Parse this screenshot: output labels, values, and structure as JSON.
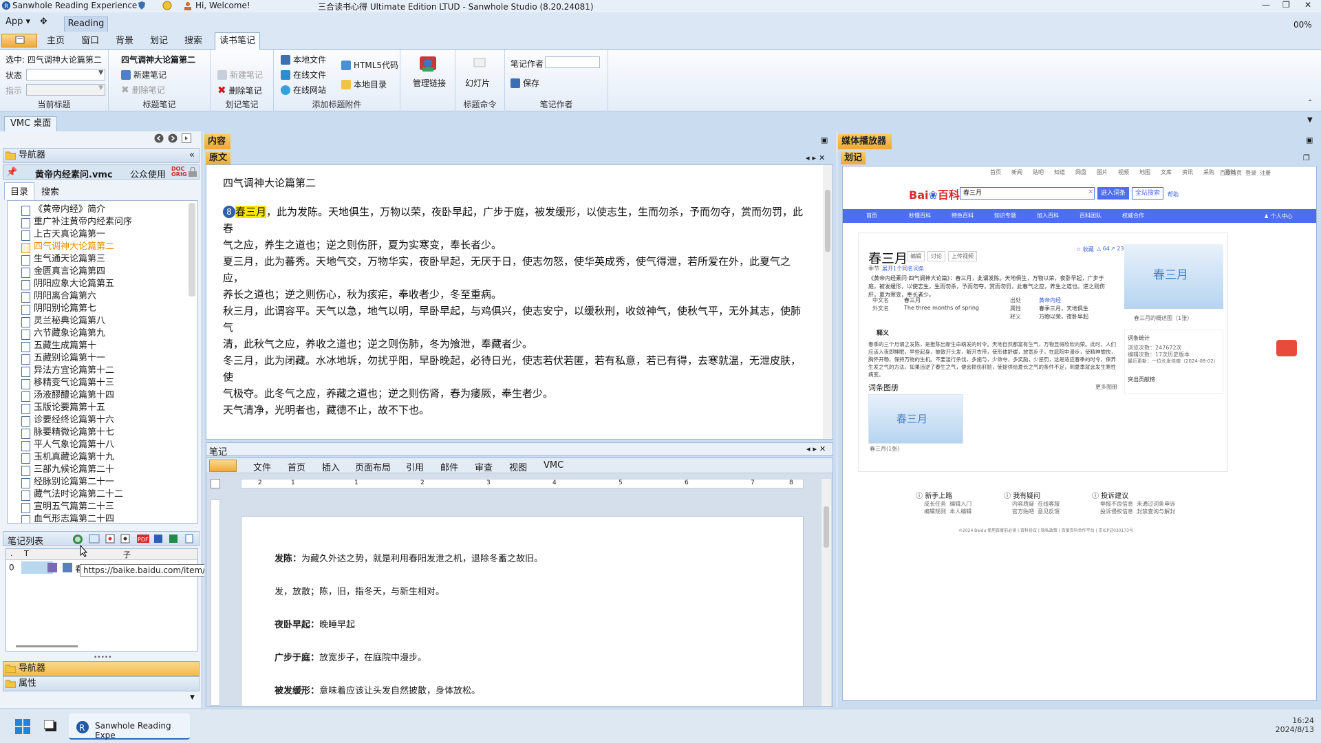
{
  "titlebar": {
    "app_name": "Sanwhole Reading Experience",
    "greeting": "Hi, Welcome!",
    "window_title": "三合读书心得 Ultimate Edition LTUD - Sanwhole Studio (8.20.24081)"
  },
  "tabrow": {
    "app_menu": "App",
    "reading_tab": "Reading",
    "zoom": "00%"
  },
  "menu": {
    "items": [
      "主页",
      "窗口",
      "背景",
      "划记",
      "搜索"
    ],
    "active": "读书笔记"
  },
  "ribbon": {
    "current": {
      "selected": "选中: 四气调神大论篇第二",
      "status_label": "状态",
      "indicator_label": "指示",
      "group": "当前标题"
    },
    "title_notes": {
      "title": "四气调神大论篇第二",
      "new": "新建笔记",
      "delete": "删除笔记",
      "group": "标题笔记"
    },
    "mark_notes": {
      "new": "新建笔记",
      "delete": "删除笔记",
      "group": "划记笔记"
    },
    "attach": {
      "local_file": "本地文件",
      "online_file": "在线文件",
      "online_site": "在线网站",
      "html5": "HTML5代码",
      "local_dir": "本地目录",
      "group": "添加标题附件"
    },
    "manage": {
      "label": "管理链接"
    },
    "slides": {
      "label": "幻灯片",
      "group": "标题命令"
    },
    "author": {
      "label": "笔记作者",
      "save": "保存",
      "group": "笔记作者"
    }
  },
  "vmc": {
    "tab": "VMC 桌面"
  },
  "left": {
    "navigator": "导航器",
    "file": "黄帝内经素问.vmc",
    "usage": "公众使用",
    "tabs": [
      "目录",
      "搜索"
    ],
    "tree": [
      "《黄帝内经》简介",
      "重广补注黄帝内经素问序",
      "上古天真论篇第一",
      "四气调神大论篇第二",
      "生气通天论篇第三",
      "金匮真言论篇第四",
      "阴阳应象大论篇第五",
      "阴阳离合篇第六",
      "阴阳别论篇第七",
      "灵兰秘典论篇第八",
      "六节藏象论篇第九",
      "五藏生成篇第十",
      "五藏别论篇第十一",
      "异法方宜论篇第十二",
      "移精变气论篇第十三",
      "汤液醪醴论篇第十四",
      "玉版论要篇第十五",
      "诊要经终论篇第十六",
      "脉要精微论篇第十七",
      "平人气象论篇第十八",
      "玉机真藏论篇第十九",
      "三部九候论篇第二十",
      "经脉别论篇第二十一",
      "藏气法时论篇第二十二",
      "宣明五气篇第二十三",
      "血气形志篇第二十四"
    ],
    "selected_index": 3,
    "notes_list": "笔记列表",
    "grid_headers": [
      ".",
      "T",
      "子"
    ],
    "grid_row": {
      "num": "0",
      "text": "春"
    },
    "bottom_nav": "导航器",
    "bottom_props": "属性"
  },
  "tooltip": "https://baike.baidu.com/item/%E6%98%A5%E4%B8%89%E6%9C%88/861835?fr=ge_ala",
  "content": {
    "header": "内容",
    "tab": "原文",
    "doc_title": "四气调神大论篇第二",
    "badge": "8",
    "highlight": "春三月",
    "p1a": "，此为发陈。天地俱生，万物以荣，夜卧早起，广步于庭，被发缓形，以使志生，生而勿杀，予而勿夺，赏而勿罚，此春",
    "p1b": "气之应，养生之道也；逆之则伤肝，夏为实寒变，奉长者少。",
    "p2a": "夏三月，此为蕃秀。天地气交，万物华实，夜卧早起，无厌于日，使志勿怒，使华英成秀，使气得泄，若所爱在外，此夏气之应，",
    "p2b": "养长之道也；逆之则伤心，秋为痎疟，奉收者少，冬至重病。",
    "p3a": "秋三月，此谓容平。天气以急，地气以明，早卧早起，与鸡俱兴，使志安宁，以缓秋刑，收敛神气，使秋气平，无外其志，使肺气",
    "p3b": "清，此秋气之应，养收之道也；逆之则伤肺，冬为飧泄，奉藏者少。",
    "p4a": "冬三月，此为闭藏。水冰地坼，勿扰乎阳，早卧晚起，必待日光，使志若伏若匿，若有私意，若已有得，去寒就温，无泄皮肤，使",
    "p4b": "气极夺。此冬气之应，养藏之道也；逆之则伤肾，春为痿厥，奉生者少。",
    "p5": "天气清净，光明者也，藏德不止，故不下也。",
    "notes_tab": "笔记",
    "word_menu": [
      "文件",
      "首页",
      "插入",
      "页面布局",
      "引用",
      "邮件",
      "审查",
      "视图",
      "VMC"
    ],
    "ruler": [
      "2",
      "1",
      "1",
      "2",
      "3",
      "4",
      "5",
      "6",
      "7",
      "8"
    ],
    "notes": [
      {
        "term": "发陈：",
        "text": "为藏久外达之势，就是利用春阳发泄之机，退除冬蓄之故旧。"
      },
      {
        "term": "",
        "text": "发，放散；陈，旧，指冬天，与新生相对。"
      },
      {
        "term": "夜卧早起：",
        "text": "晚睡早起"
      },
      {
        "term": "广步于庭：",
        "text": "放宽步子，在庭院中漫步。"
      },
      {
        "term": "被发缓形：",
        "text": "意味着应该让头发自然披散，身体放松。"
      }
    ]
  },
  "media": {
    "header": "媒体播放器",
    "tab": "划记",
    "baidu": {
      "toplinks": [
        "首页",
        "新闻",
        "贴吧",
        "知道",
        "网盘",
        "图片",
        "视频",
        "地图",
        "文库",
        "资讯",
        "采购",
        "百科"
      ],
      "toplinks_right": [
        "百度首页",
        "登录",
        "注册"
      ],
      "search_value": "春三月",
      "enter_btn": "进入词条",
      "search_btn": "全站搜索",
      "help": "帮助",
      "nav": [
        "首页",
        "秒懂百科",
        "特色百科",
        "知识专题",
        "加入百科",
        "百科团队",
        "权威合作"
      ],
      "nav_right": "个人中心",
      "term": "春三月",
      "term_sub": "季节",
      "poly": "展开1个同名词条",
      "btns": [
        "编辑",
        "讨论",
        "上传视频"
      ],
      "collect": "收藏",
      "likes": "64",
      "share": "23",
      "summary": "《黄帝内经素问·四气调神大论篇》：春三月，此谓发陈。天地俱生，万物以荣，夜卧早起，广步于庭，被发缓形，以使志生，生而勿杀，予而勿夺，赏而勿罚，此春气之应，养生之道也。逆之则伤肝，夏为寒变，奉长者少。",
      "info_l": [
        [
          "中文名",
          "春三月"
        ],
        [
          "外文名",
          "The three months of spring"
        ]
      ],
      "info_r": [
        [
          "出处",
          "黄帝内经"
        ],
        [
          "属性",
          "春季三月，天地俱生"
        ],
        [
          "释义",
          "万物以荣，夜卧早起"
        ]
      ],
      "section": "释义",
      "body": "春季的三个月谓之发陈，是推陈出新生命萌发的时令。天地自然都富有生气，万物显得欣欣向荣。此时，人们应该入夜即睡眠，早些起身，披散开头发，解开衣带，使形体舒缓，放宽步子，在庭院中漫步，使精神愉快，胸怀开畅，保持万物的生机。不要滥行杀伐，多施与，少敛夺，多奖励，少惩罚，这是适应春季的时令，保养生发之气的方法。如果违逆了春生之气，便会损伤肝脏，使提供给夏长之气的条件不足，到夏季就会发生寒性病变。",
      "album": "词条图册",
      "album_more": "更多图册",
      "image_text": "春三月",
      "album_caption": "春三月(1张)",
      "image_caption": "春三月的概述图（1张）",
      "stats_title": "词条统计",
      "stats": [
        "浏览次数：247672次",
        "编辑次数：17次历史版本",
        "最近更新：一位长发佳南（2024-08-02）"
      ],
      "contrib": "突出贡献榜",
      "footer": [
        [
          "新手上路",
          "成长任务",
          "编辑入门",
          "编辑规则",
          "本人编辑"
        ],
        [
          "我有疑问",
          "内容质疑",
          "在线客服",
          "官方贴吧",
          "意见反馈"
        ],
        [
          "投诉建议",
          "举报不良信息",
          "未通过词条申诉",
          "投诉侵权信息",
          "封禁查询与解封"
        ]
      ],
      "copyright": "©2024 Baidu 使用百度前必读 | 百科协议 | 隐私政策 | 百度百科合作平台 | 京ICP证030173号"
    }
  },
  "taskbar": {
    "app": "Sanwhole Reading Expe",
    "time": "16:24",
    "date": "2024/8/13"
  }
}
